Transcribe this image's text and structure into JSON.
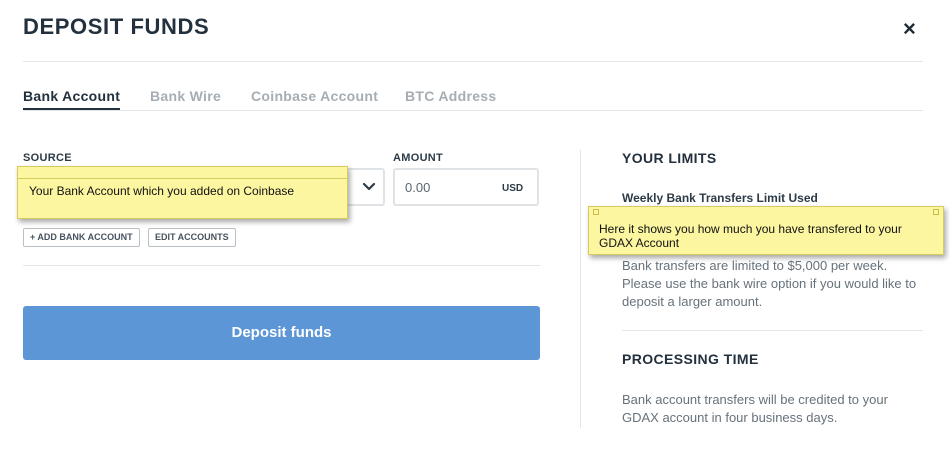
{
  "header": {
    "title": "DEPOSIT FUNDS",
    "close_icon": "×"
  },
  "tabs": [
    {
      "label": "Bank Account",
      "active": true
    },
    {
      "label": "Bank Wire",
      "active": false
    },
    {
      "label": "Coinbase Account",
      "active": false
    },
    {
      "label": "BTC Address",
      "active": false
    }
  ],
  "form": {
    "source_label": "SOURCE",
    "amount_label": "AMOUNT",
    "amount_value": "0.00",
    "amount_unit": "USD",
    "add_bank_label": "+ ADD BANK ACCOUNT",
    "edit_accounts_label": "EDIT ACCOUNTS",
    "deposit_label": "Deposit funds"
  },
  "limits": {
    "heading": "YOUR LIMITS",
    "weekly_label": "Weekly Bank Transfers Limit Used",
    "description": "Bank transfers are limited to $5,000 per week. Please use the bank wire option if you would like to deposit a larger amount."
  },
  "processing": {
    "heading": "PROCESSING TIME",
    "description": "Bank account transfers will be credited to your GDAX account in four business days."
  },
  "annotations": {
    "source_note": "Your Bank Account which you added on Coinbase",
    "limit_note": "Here it shows you how much you have transfered to your GDAX Account"
  },
  "colors": {
    "accent": "#5d96d7",
    "sticky_note": "#fcf6a1",
    "text_dark": "#23303d",
    "tab_inactive": "#a6adb3"
  }
}
